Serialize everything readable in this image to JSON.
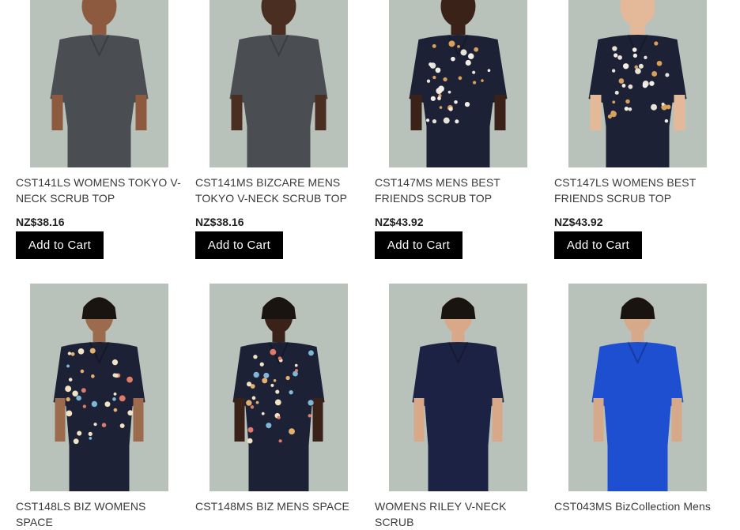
{
  "products": [
    {
      "title": "CST141LS WOMENS TOKYO V-NECK SCRUB TOP",
      "price": "NZ$38.16",
      "button": "Add to Cart",
      "scrub_color": "#4a4d51",
      "pattern": "none",
      "pants_color": "#4a4d51",
      "skin": "#8d5a3f"
    },
    {
      "title": "CST141MS BIZCARE MENS TOKYO V-NECK SCRUB TOP",
      "price": "NZ$38.16",
      "button": "Add to Cart",
      "scrub_color": "#4a4d51",
      "pattern": "none",
      "pants_color": "#4a4d51",
      "skin": "#4a2e22"
    },
    {
      "title": "CST147MS MENS BEST FRIENDS SCRUB TOP",
      "price": "NZ$43.92",
      "button": "Add to Cart",
      "scrub_color": "#1c2136",
      "pattern": "animals",
      "pants_color": "#1c2136",
      "skin": "#3b2218"
    },
    {
      "title": "CST147LS WOMENS BEST FRIENDS SCRUB TOP",
      "price": "NZ$43.92",
      "button": "Add to Cart",
      "scrub_color": "#1c2136",
      "pattern": "animals",
      "pants_color": "#1c2136",
      "skin": "#e3b999"
    },
    {
      "title": "CST148LS BIZ WOMENS SPACE",
      "price": "",
      "button": "",
      "scrub_color": "#1c2136",
      "pattern": "space",
      "pants_color": "#1c2136",
      "skin": "#9c6a4c"
    },
    {
      "title": "CST148MS BIZ MENS SPACE",
      "price": "",
      "button": "",
      "scrub_color": "#1c2136",
      "pattern": "space",
      "pants_color": "#1c2136",
      "skin": "#3b2218"
    },
    {
      "title": "WOMENS RILEY V-NECK SCRUB",
      "price": "",
      "button": "",
      "scrub_color": "#1c2244",
      "pattern": "none",
      "pants_color": "#1c2244",
      "skin": "#d9a889"
    },
    {
      "title": "CST043MS BizCollection Mens",
      "price": "",
      "button": "",
      "scrub_color": "#1f4fd1",
      "pattern": "none",
      "pants_color": "#1f4fd1",
      "skin": "#d6a98a"
    }
  ]
}
